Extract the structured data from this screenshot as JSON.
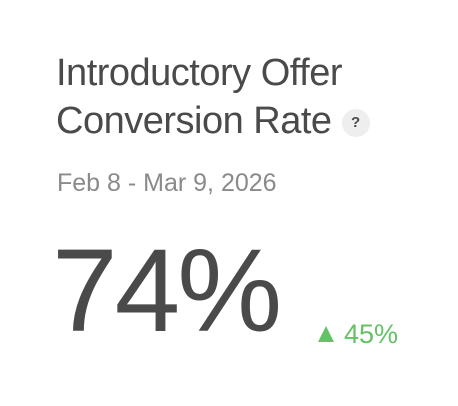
{
  "card": {
    "title_line_1": "Introductory Offer",
    "title_line_2": "Conversion Rate",
    "help_icon_glyph": "?",
    "date_range": "Feb 8 - Mar 9, 2026",
    "metric_value": "74%",
    "change": {
      "direction": "up",
      "value": "45%",
      "icon": "triangle-up-icon",
      "color": "#66c166"
    }
  }
}
